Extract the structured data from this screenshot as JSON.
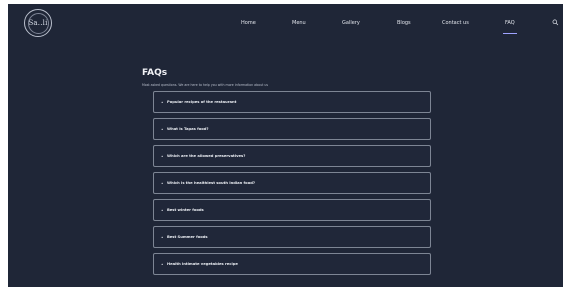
{
  "logo": {
    "text": "Sa..li"
  },
  "nav": {
    "items": [
      {
        "label": "Home"
      },
      {
        "label": "Menu"
      },
      {
        "label": "Gallery"
      },
      {
        "label": "Blogs"
      },
      {
        "label": "Contact us"
      },
      {
        "label": "FAQ"
      }
    ],
    "active": "FAQ"
  },
  "page": {
    "title": "FAQs",
    "intro": "Most asked questions. We are here to help you with more information about us"
  },
  "faq": {
    "items": [
      {
        "label": "Popular recipes of the restaurant"
      },
      {
        "label": "What is Tapas food?"
      },
      {
        "label": "Which are the allowed preservatives?"
      },
      {
        "label": "Which is the healthiest south Indian food?"
      },
      {
        "label": "Best winter foods"
      },
      {
        "label": "Best Summer foods"
      },
      {
        "label": "Health intimate vegetables recipe"
      }
    ]
  }
}
